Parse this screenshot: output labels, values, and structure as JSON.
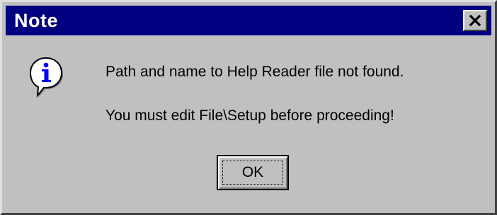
{
  "window": {
    "title": "Note",
    "titlebar_color": "#000080",
    "background_color": "#c0c0c0"
  },
  "titlebar": {
    "close_icon": "close-x-icon"
  },
  "icon": {
    "name": "information-icon",
    "glyph": "i",
    "color": "#0000ff"
  },
  "message": {
    "line1": "Path and name to Help Reader file not found.",
    "line2": "You must edit File\\Setup before proceeding!"
  },
  "buttons": {
    "ok_label": "OK"
  }
}
